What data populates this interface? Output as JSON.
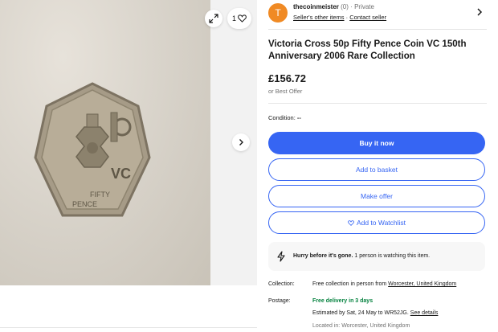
{
  "gallery": {
    "image_count": "1",
    "coin_text": {
      "left": "VC",
      "bottom1": "FIFTY",
      "bottom2": "PENCE"
    }
  },
  "seller": {
    "avatar_letter": "T",
    "name": "thecoinmeister",
    "feedback": "(0)",
    "separator": "·",
    "type": "Private",
    "other_items": "Seller's other items",
    "link_separator": "·",
    "contact": "Contact seller"
  },
  "listing": {
    "title": "Victoria Cross 50p Fifty Pence Coin VC 150th Anniversary 2006 Rare Collection",
    "price": "£156.72",
    "best_offer": "or Best Offer",
    "condition_label": "Condition:",
    "condition_value": "--"
  },
  "actions": {
    "buy_now": "Buy it now",
    "add_to_basket": "Add to basket",
    "make_offer": "Make offer",
    "watchlist": "Add to Watchlist"
  },
  "urgency": {
    "headline": "Hurry before it's gone.",
    "detail": "1 person is watching this item."
  },
  "shipping": {
    "collection_label": "Collection:",
    "collection_text": "Free collection in person from ",
    "collection_place": "Worcester, United Kingdom",
    "postage_label": "Postage:",
    "postage_free": "Free delivery in 3 days",
    "estimated_text": "Estimated by Sat, 24 May to WR52JG. ",
    "see_details": "See details",
    "located": "Located in: Worcester, United Kingdom"
  },
  "colors": {
    "accent": "#3665f3",
    "avatar": "#f08a24",
    "free_green": "#05823f"
  }
}
